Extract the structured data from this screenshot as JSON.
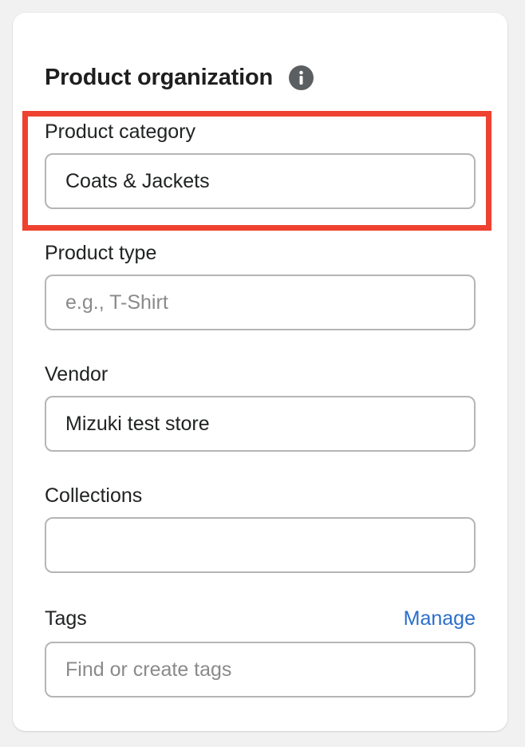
{
  "card": {
    "title": "Product organization",
    "info_icon": "info-icon"
  },
  "fields": {
    "category": {
      "label": "Product category",
      "value": "Coats & Jackets",
      "placeholder": ""
    },
    "type": {
      "label": "Product type",
      "value": "",
      "placeholder": "e.g., T-Shirt"
    },
    "vendor": {
      "label": "Vendor",
      "value": "Mizuki test store",
      "placeholder": ""
    },
    "collections": {
      "label": "Collections",
      "value": "",
      "placeholder": ""
    },
    "tags": {
      "label": "Tags",
      "manage_label": "Manage",
      "value": "",
      "placeholder": "Find or create tags"
    }
  },
  "colors": {
    "highlight": "#ef4130",
    "link": "#2c6ecb",
    "icon": "#5c5f62"
  }
}
